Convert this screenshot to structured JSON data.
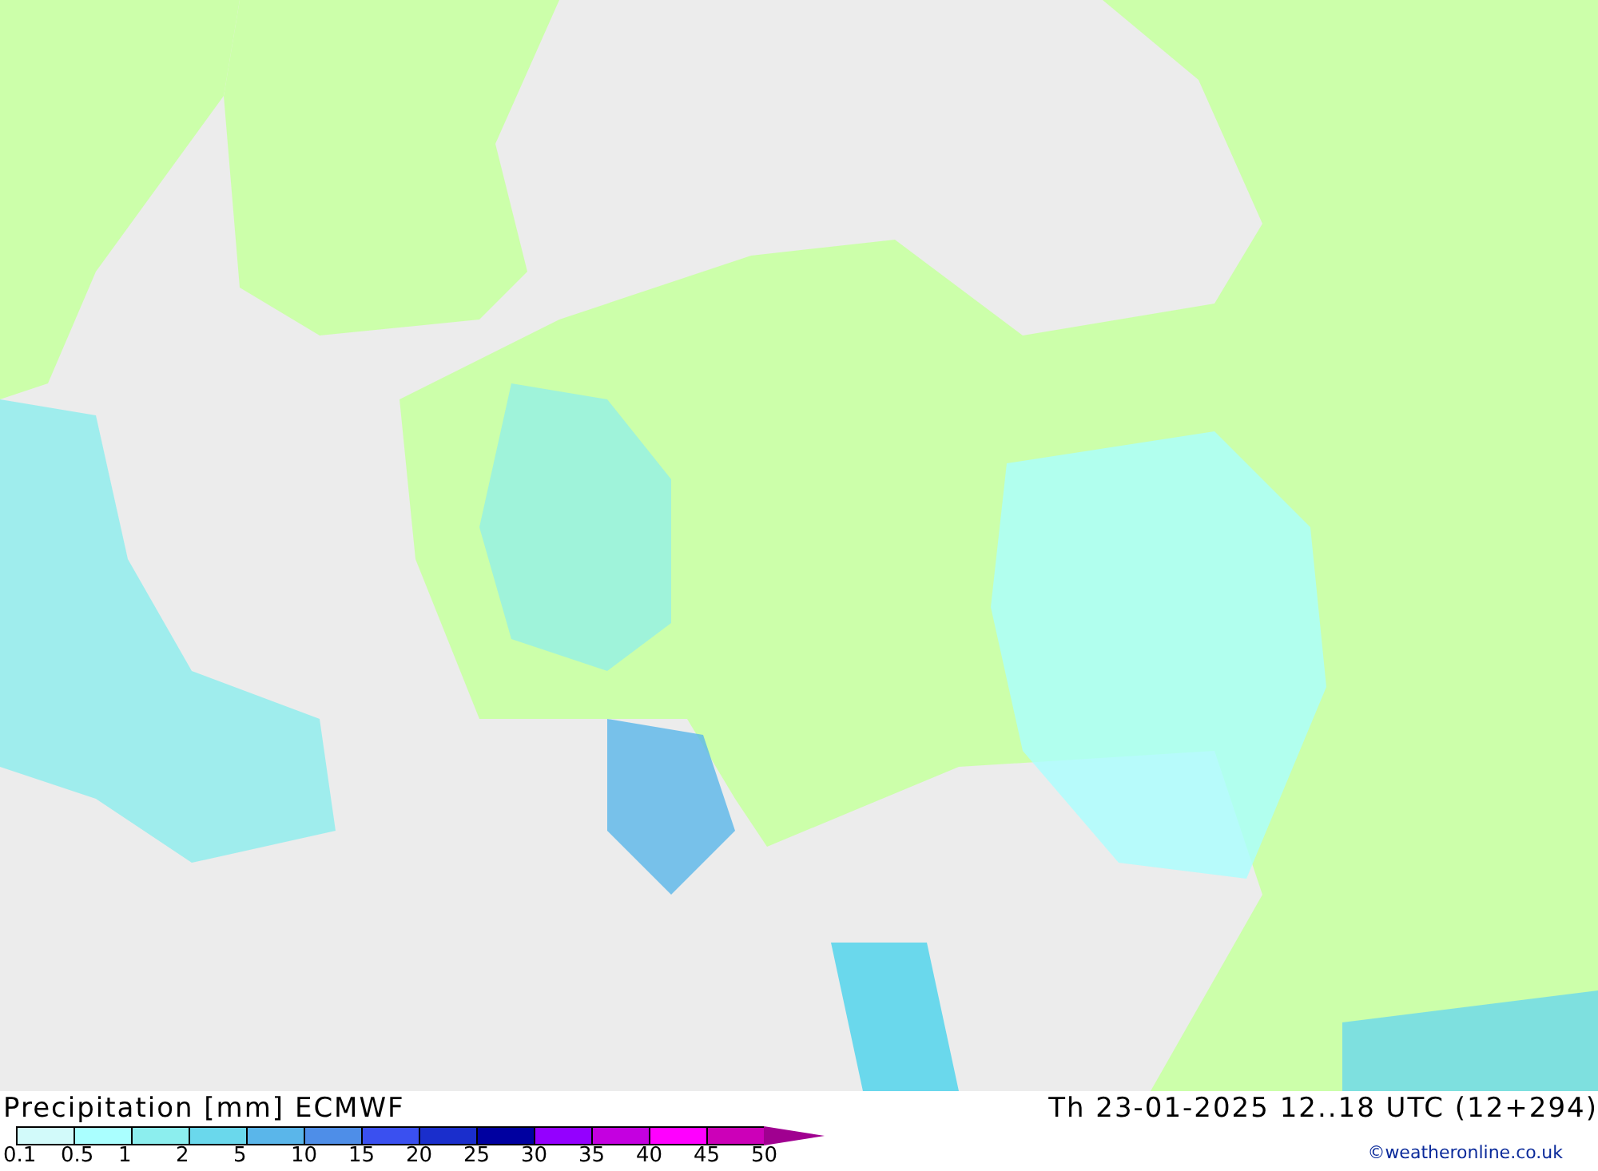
{
  "title": "Precipitation [mm] ECMWF",
  "valid_time": "Th 23-01-2025 12..18 UTC (12+294)",
  "legend": {
    "swatches": [
      {
        "color": "#d2fafa"
      },
      {
        "color": "#aaffff"
      },
      {
        "color": "#8ceeee"
      },
      {
        "color": "#6ad8ec"
      },
      {
        "color": "#5ab6ea"
      },
      {
        "color": "#4e8ee8"
      },
      {
        "color": "#3a50f0"
      },
      {
        "color": "#1a2ecc"
      },
      {
        "color": "#0000a0"
      },
      {
        "color": "#9400ff"
      },
      {
        "color": "#c400e0"
      },
      {
        "color": "#ff00ff"
      },
      {
        "color": "#cc00b8"
      },
      {
        "kind": "arrow",
        "color": "#a00090"
      }
    ],
    "labels": [
      "0.1",
      "0.5",
      "1",
      "2",
      "5",
      "10",
      "15",
      "20",
      "25",
      "30",
      "35",
      "40",
      "45",
      "50"
    ]
  },
  "credit": "©weatheronline.co.uk"
}
